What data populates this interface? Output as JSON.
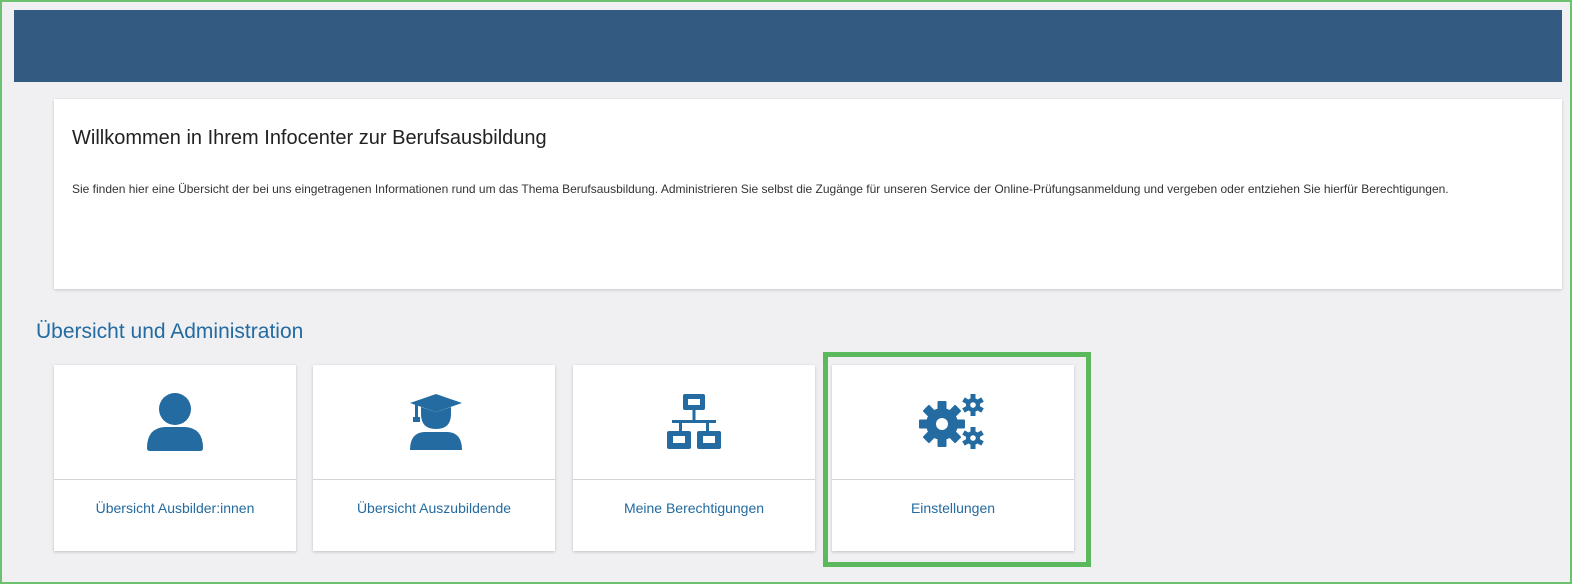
{
  "welcome": {
    "title": "Willkommen in Ihrem Infocenter zur Berufsausbildung",
    "text": "Sie finden hier eine Übersicht der bei uns eingetragenen Informationen rund um das Thema Berufsausbildung. Administrieren Sie selbst die Zugänge für unseren Service der Online-Prüfungsanmeldung und vergeben oder entziehen Sie hierfür Berechtigungen."
  },
  "section": {
    "title": "Übersicht und Administration"
  },
  "tiles": [
    {
      "label": "Übersicht Ausbilder:innen",
      "icon": "user-icon"
    },
    {
      "label": "Übersicht Auszubildende",
      "icon": "graduate-icon"
    },
    {
      "label": "Meine Berechtigungen",
      "icon": "network-icon"
    },
    {
      "label": "Einstellungen",
      "icon": "gears-icon"
    }
  ],
  "colors": {
    "header": "#335b82",
    "accent": "#236ba0",
    "highlight": "#5cb85c",
    "background": "#f0f0f2"
  }
}
